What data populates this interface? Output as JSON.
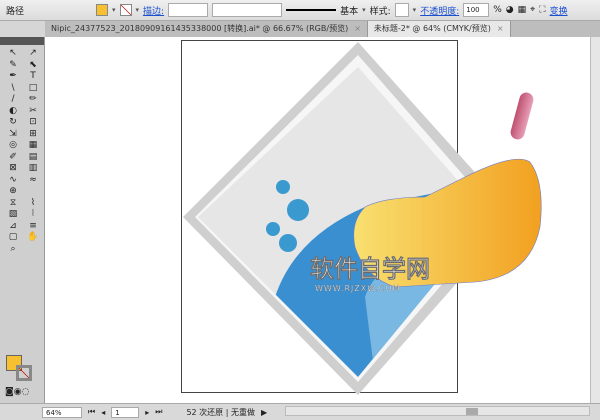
{
  "control_bar": {
    "mode_label": "路径",
    "stroke_label": "描边:",
    "stroke_style": "基本",
    "style_label": "样式:",
    "opacity_label": "不透明度:",
    "opacity_value": "100",
    "percent": "%",
    "transform_label": "变换"
  },
  "tabs": [
    {
      "label": "Nipic_24377523_20180909161435338000 [转换].ai* @ 66.67% (RGB/预览)",
      "active": false
    },
    {
      "label": "未标题-2* @ 64% (CMYK/预览)",
      "active": true
    }
  ],
  "tools": [
    "↖",
    "↗",
    "✎",
    "⬉",
    "✒",
    "T",
    "\\",
    "□",
    "/",
    "✏",
    "◐",
    "✂",
    "↻",
    "⊡",
    "⇲",
    "⊞",
    "◎",
    "▦",
    "✐",
    "▤",
    "⊠",
    "▥",
    "∿",
    "≈",
    "⊕",
    "",
    "⧖",
    "⌇",
    "▧",
    "⦚",
    "⊿",
    "≡",
    "▢",
    "✋",
    "⌕",
    ""
  ],
  "watermark": {
    "title": "软件自学网",
    "url": "WWW.RJZXW.COM"
  },
  "status": {
    "zoom": "64%",
    "page": "1",
    "message": "52 次还原 | 无重做"
  },
  "colors": {
    "fill": "#f7c030",
    "accent_link": "#1a4fd0",
    "water": "#3a8fd0",
    "brush": "#f2a93a"
  }
}
